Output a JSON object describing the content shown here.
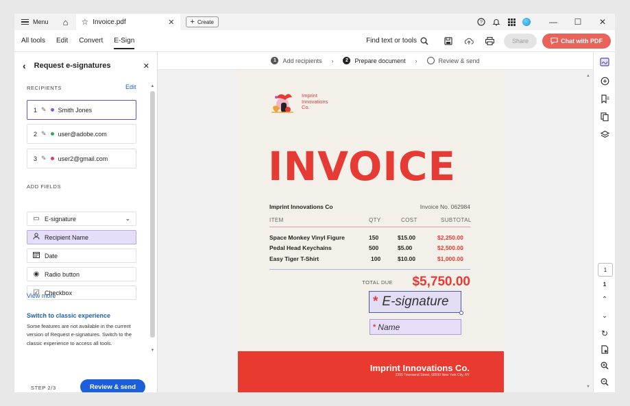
{
  "tabbar": {
    "menu_label": "Menu",
    "tab_title": "Invoice.pdf",
    "create_label": "Create",
    "icons": [
      "help-icon",
      "bell-icon",
      "apps-icon",
      "avatar"
    ],
    "window_controls": [
      "minimize",
      "maximize",
      "close"
    ]
  },
  "toolbar": {
    "tabs": [
      "All tools",
      "Edit",
      "Convert",
      "E-Sign"
    ],
    "active_tab": "E-Sign",
    "find_label": "Find text or tools",
    "share_label": "Share",
    "chat_label": "Chat with PDF"
  },
  "panel": {
    "title": "Request e-signatures",
    "recipients_label": "RECIPIENTS",
    "edit_label": "Edit",
    "recipients": [
      {
        "num": "1",
        "name": "Smith Jones",
        "color": "#7b5cd6"
      },
      {
        "num": "2",
        "name": "user@adobe.com",
        "color": "#3aa757"
      },
      {
        "num": "3",
        "name": "user2@gmail.com",
        "color": "#e0347a"
      }
    ],
    "add_fields_label": "ADD FIELDS",
    "fields": [
      {
        "label": "E-signature",
        "icon": "signature-icon"
      },
      {
        "label": "Recipient Name",
        "icon": "person-icon"
      },
      {
        "label": "Date",
        "icon": "calendar-icon"
      },
      {
        "label": "Radio button",
        "icon": "radio-icon"
      },
      {
        "label": "Checkbox",
        "icon": "checkbox-icon"
      }
    ],
    "view_more": "View more",
    "switch_link": "Switch to classic experience",
    "switch_desc": "Some features are not available in the current version of Request e-signatures. Switch to the classic experience to access all tools.",
    "step_label": "STEP 2/3",
    "review_button": "Review & send"
  },
  "steps": [
    {
      "num": "1",
      "label": "Add recipients"
    },
    {
      "num": "2",
      "label": "Prepare document"
    },
    {
      "num": "",
      "label": "Review & send"
    }
  ],
  "invoice": {
    "logo_text": [
      "Imprint",
      "Innovations",
      "Co."
    ],
    "heading": "INVOICE",
    "company": "Imprint Innovations Co",
    "invoice_no": "Invoice No. 062984",
    "columns": [
      "ITEM",
      "QTY",
      "COST",
      "SUBTOTAL"
    ],
    "items": [
      {
        "item": "Space Monkey Vinyl Figure",
        "qty": "150",
        "cost": "$15.00",
        "subtotal": "$2,250.00"
      },
      {
        "item": "Pedal Head Keychains",
        "qty": "500",
        "cost": "$5.00",
        "subtotal": "$2,500.00"
      },
      {
        "item": "Easy Tiger T-Shirt",
        "qty": "100",
        "cost": "$10.00",
        "subtotal": "$1,000.00"
      }
    ],
    "total_label": "TOTAL DUE",
    "total_value": "$5,750.00",
    "esig_field": "E-signature",
    "name_field": "Name",
    "required_mark": "*",
    "footer_company": "Imprint Innovations Co.",
    "footer_address": "2355 Townsend Street, 68930 New York City, NY"
  },
  "rail": {
    "page_current": "1",
    "page_total": "1"
  }
}
